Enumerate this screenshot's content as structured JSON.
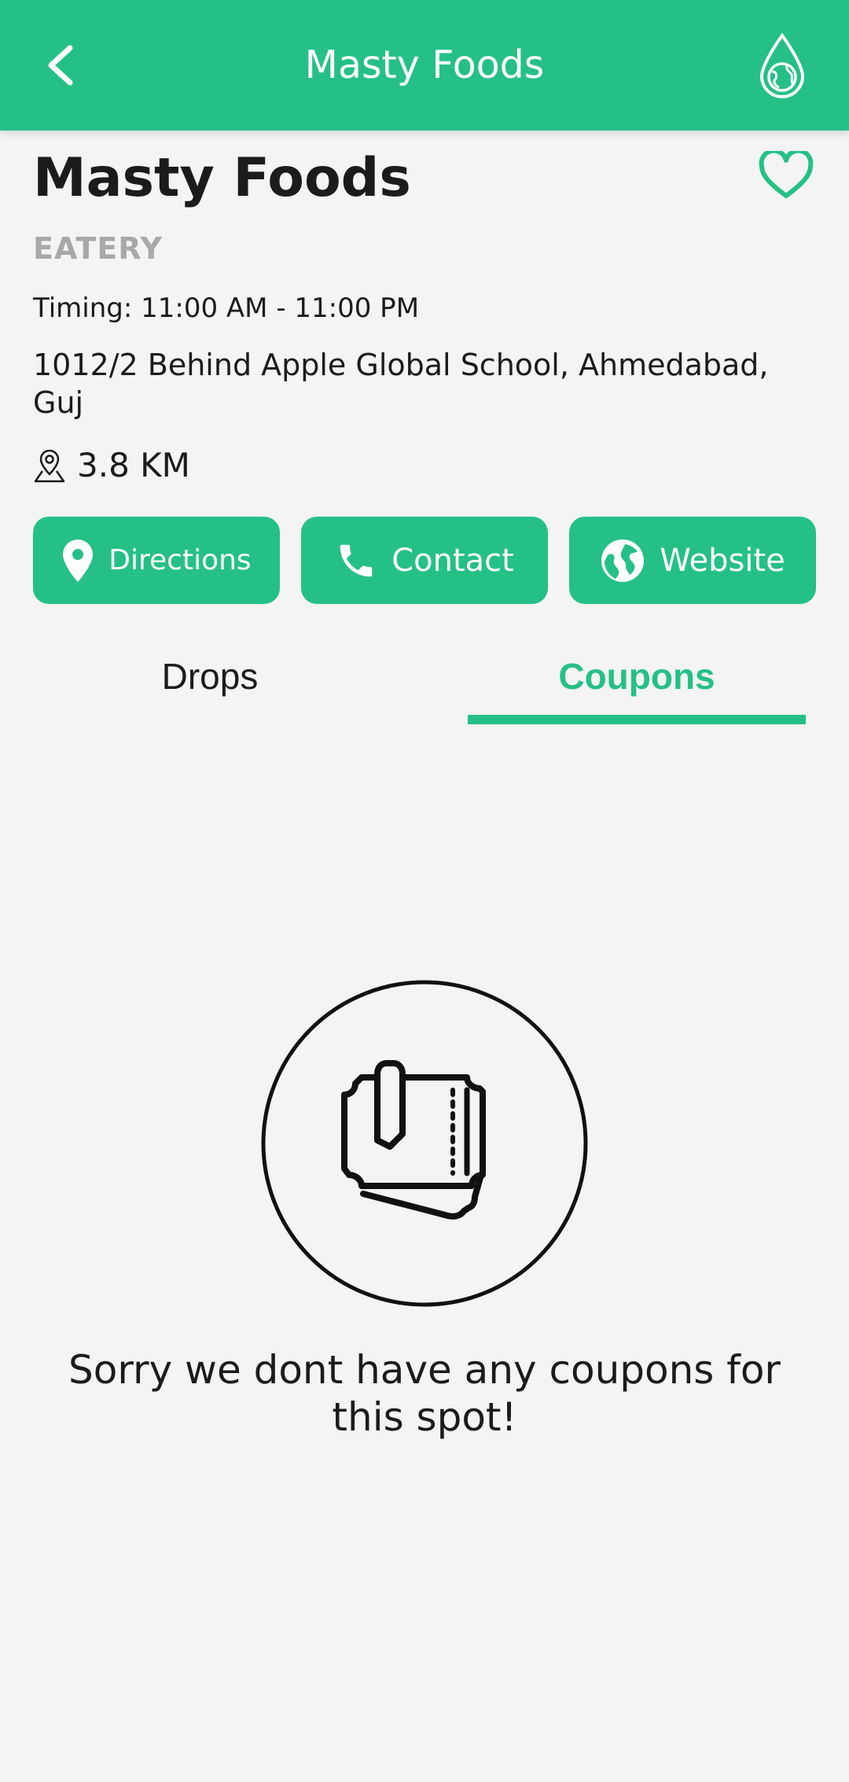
{
  "app_bar": {
    "title": "Masty Foods",
    "back_icon": "chevron-left-icon",
    "action_icon": "drop-globe-icon",
    "background": "#25c086"
  },
  "spot": {
    "name": "Masty Foods",
    "category": "EATERY",
    "timing": "Timing: 11:00 AM - 11:00 PM",
    "address": "1012/2 Behind Apple Global School, Ahmedabad, Guj",
    "distance": "3.8 KM",
    "favorite_icon": "heart-outline-icon"
  },
  "actions": {
    "directions": {
      "label": "Directions",
      "icon": "location-pin-icon"
    },
    "contact": {
      "label": "Contact",
      "icon": "phone-icon"
    },
    "website": {
      "label": "Website",
      "icon": "globe-icon"
    }
  },
  "tabs": {
    "items": [
      {
        "label": "Drops",
        "selected": false
      },
      {
        "label": "Coupons",
        "selected": true
      }
    ]
  },
  "empty_state": {
    "icon": "coupon-tickets-icon",
    "message": "Sorry we dont have any coupons for this spot!"
  },
  "colors": {
    "accent": "#25c086",
    "background": "#f3f4f3",
    "muted_text": "#a8a8a8",
    "text": "#1b1b1b"
  }
}
